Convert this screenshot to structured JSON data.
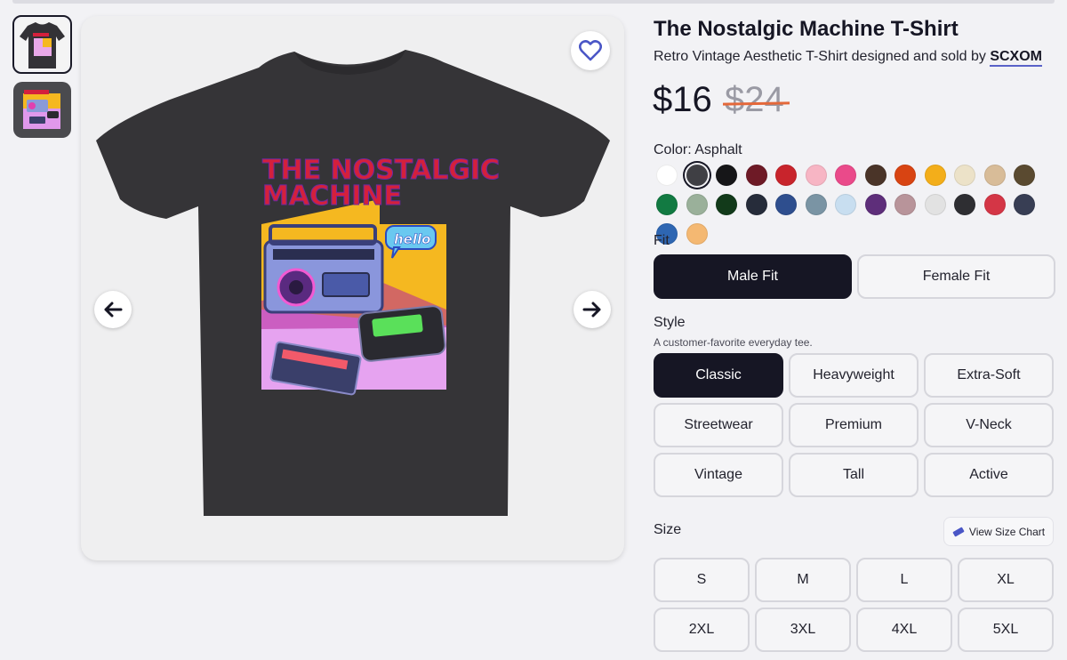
{
  "product": {
    "title": "The Nostalgic Machine T-Shirt",
    "subtitle_prefix": "Retro Vintage Aesthetic T-Shirt designed and sold by ",
    "seller": "SCXOM",
    "price": "$16",
    "original_price": "$24"
  },
  "artwork": {
    "line1": "THE NOSTALGIC",
    "line2": "MACHINE",
    "bubble": "hello"
  },
  "color": {
    "label": "Color: Asphalt",
    "selected_index": 1,
    "swatches": [
      "#ffffff",
      "#3f3f44",
      "#161618",
      "#6e1a26",
      "#c8242c",
      "#f7b5c4",
      "#ea4a8a",
      "#4a3428",
      "#d84412",
      "#f3ae1a",
      "#ece2c8",
      "#d8bc98",
      "#5a4a30",
      "#127a42",
      "#9ab09a",
      "#123a1a",
      "#262c3a",
      "#2e4e8e",
      "#7a94a4",
      "#c8def0",
      "#5e2e7a",
      "#b8949a",
      "#e2e2e2",
      "#2e2e32",
      "#d43646",
      "#383e54",
      "#2e66b2",
      "#f4b872"
    ]
  },
  "fit": {
    "label": "Fit",
    "options": [
      "Male Fit",
      "Female Fit"
    ],
    "selected": "Male Fit"
  },
  "style": {
    "label": "Style",
    "note": "A customer-favorite everyday tee.",
    "options": [
      "Classic",
      "Heavyweight",
      "Extra-Soft",
      "Streetwear",
      "Premium",
      "V-Neck",
      "Vintage",
      "Tall",
      "Active"
    ],
    "selected": "Classic"
  },
  "size": {
    "label": "Size",
    "chart_button": "View Size Chart",
    "options": [
      "S",
      "M",
      "L",
      "XL",
      "2XL",
      "3XL",
      "4XL",
      "5XL"
    ]
  },
  "icons": {
    "favorite": "heart-icon",
    "prev": "arrow-left-icon",
    "next": "arrow-right-icon",
    "size_chart": "ruler-icon"
  }
}
